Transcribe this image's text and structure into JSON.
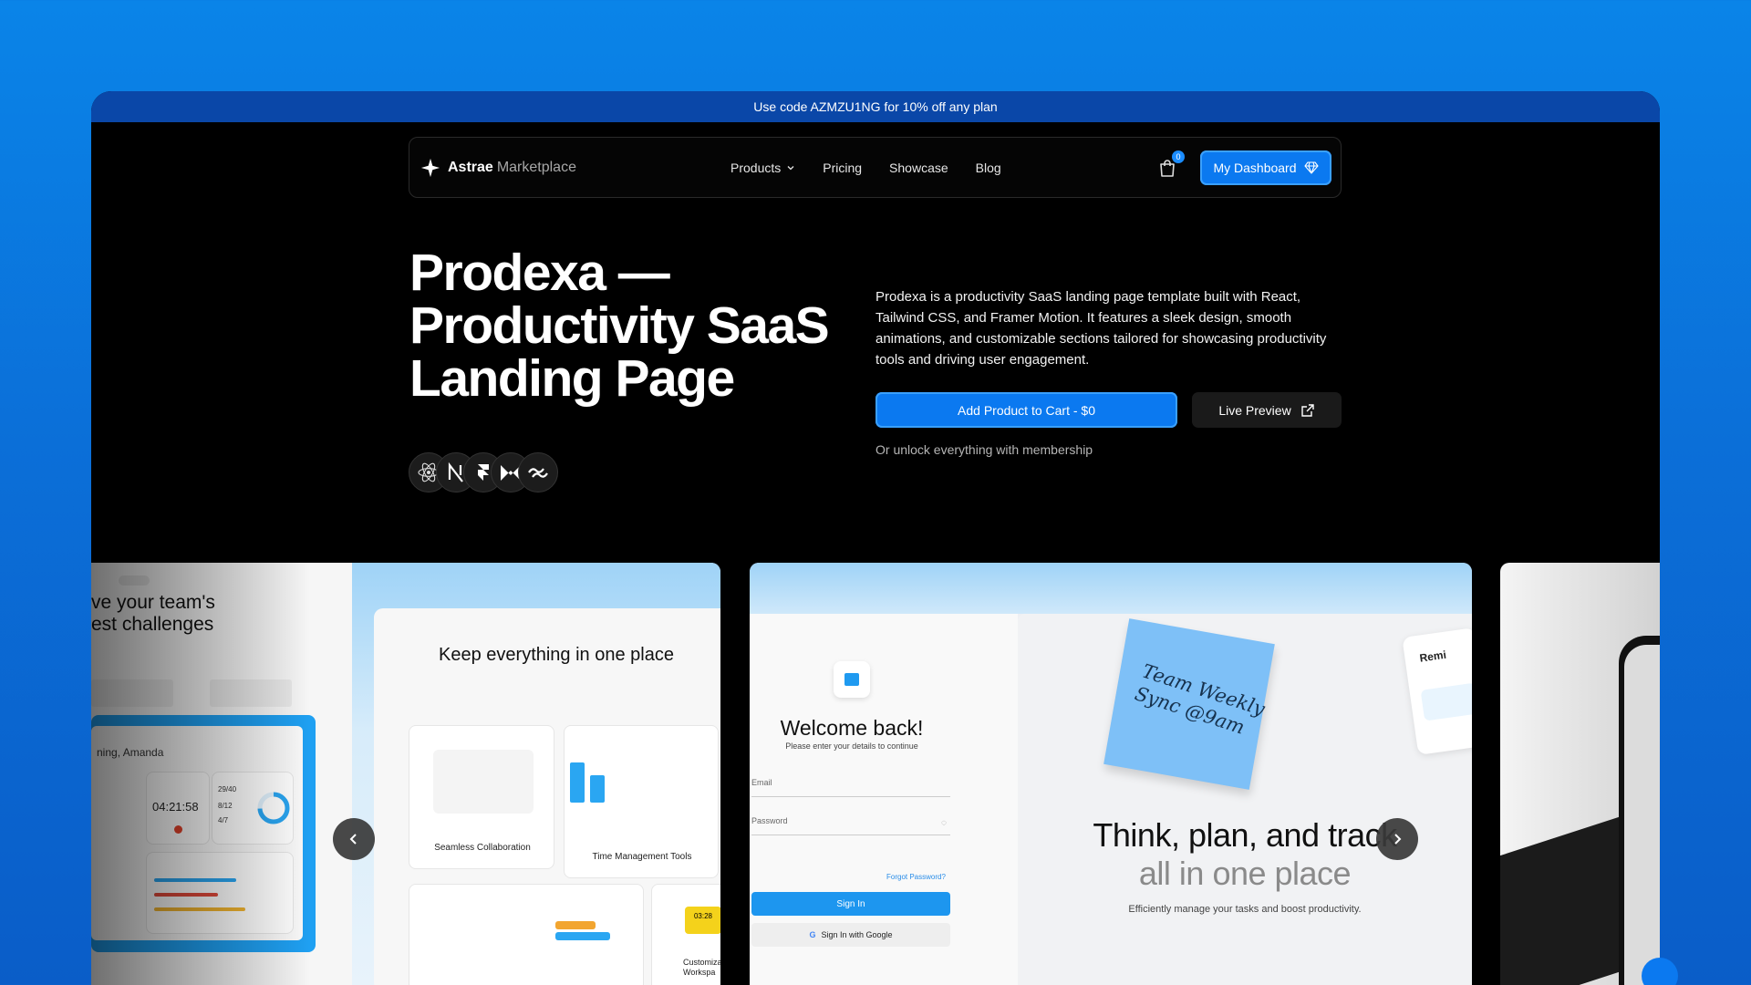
{
  "promo": {
    "text": "Use code AZMZU1NG for 10% off any plan"
  },
  "nav": {
    "brand_name": "Astrae",
    "brand_suffix": "Marketplace",
    "links": [
      "Products",
      "Pricing",
      "Showcase",
      "Blog"
    ],
    "cart_count": "0",
    "dashboard_label": "My Dashboard"
  },
  "hero": {
    "title_line1": "Prodexa —",
    "title_line2": "Productivity SaaS",
    "title_line3": "Landing Page",
    "tech_icons": [
      "react-icon",
      "nextjs-icon",
      "framer-icon",
      "framer-motion-icon",
      "tailwind-icon"
    ],
    "description": "Prodexa is a productivity SaaS landing page template built with React, Tailwind CSS, and Framer Motion. It features a sleek design, smooth animations, and customizable sections tailored for showcasing productivity tools and driving user engagement.",
    "add_to_cart": "Add Product to Cart - $0",
    "live_preview": "Live Preview",
    "unlock": "Or unlock everything with membership"
  },
  "gallery": {
    "card1": {
      "headline_1": "ve your team's",
      "headline_2": "est challenges",
      "greeting": "ning, Amanda",
      "timer": "04:21:58",
      "stat_1": "29/40",
      "stat_2": "8/12",
      "stat_3": "4/7",
      "section_title": "Keep everything in one place",
      "feature_1": "Seamless Collaboration",
      "feature_2": "Time Management Tools",
      "feature_3": "Customiza Workspa",
      "mini_timer": "03:28"
    },
    "card2": {
      "welcome": "Welcome back!",
      "subtitle": "Please enter your details to continue",
      "email_label": "Email",
      "password_label": "Password",
      "forgot": "Forgot Password?",
      "sign_in": "Sign In",
      "google": "Sign In with Google",
      "sticky": "Team Weekly Sync @9am",
      "headline_1": "Think, plan, and track",
      "headline_2": "all in one place",
      "tagline": "Efficiently manage your tasks and boost productivity.",
      "reminder": "Remi"
    }
  },
  "colors": {
    "background": "#0a84e8",
    "accent": "#0b79f0",
    "promo_bar": "#0a47a8"
  }
}
